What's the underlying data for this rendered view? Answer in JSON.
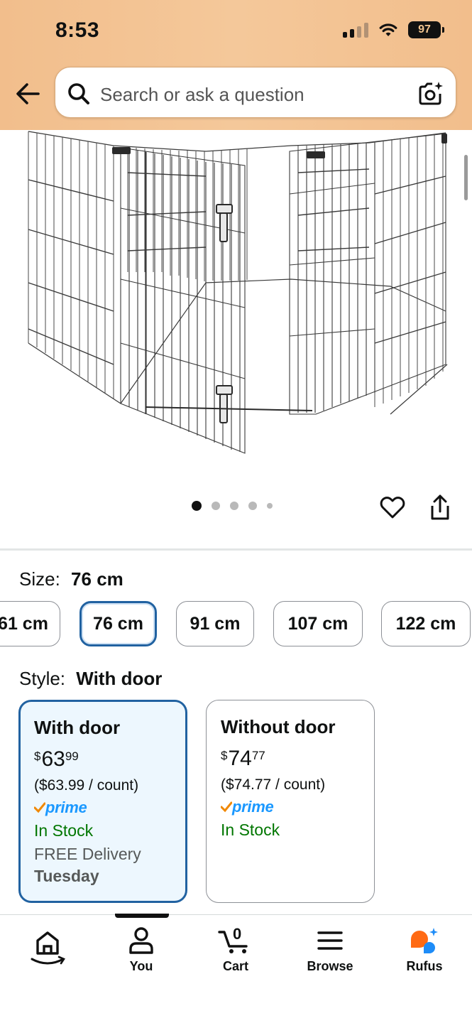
{
  "status_bar": {
    "time": "8:53",
    "battery": "97"
  },
  "search": {
    "placeholder": "Search or ask a question"
  },
  "carousel": {
    "total_images": 5,
    "active_index": 0
  },
  "size": {
    "label": "Size:",
    "selected": "76 cm",
    "options": [
      "61 cm",
      "76 cm",
      "91 cm",
      "107 cm",
      "122 cm"
    ]
  },
  "style": {
    "label": "Style:",
    "selected": "With door",
    "options": [
      {
        "name": "With door",
        "price_symbol": "$",
        "price_whole": "63",
        "price_fraction": "99",
        "unit_price": "($63.99 / count)",
        "prime": "prime",
        "stock": "In Stock",
        "delivery": "FREE Delivery",
        "delivery_day": "Tuesday"
      },
      {
        "name": "Without door",
        "price_symbol": "$",
        "price_whole": "74",
        "price_fraction": "77",
        "unit_price": "($74.77 / count)",
        "prime": "prime",
        "stock": "In Stock"
      }
    ]
  },
  "nav": {
    "cart_count": "0",
    "items": [
      {
        "label": ""
      },
      {
        "label": "You"
      },
      {
        "label": "Cart"
      },
      {
        "label": "Browse"
      },
      {
        "label": "Rufus"
      }
    ]
  },
  "colors": {
    "header_bg": "#f2be8c",
    "selected_border": "#2162a1",
    "selected_bg": "#edf7fe",
    "in_stock": "#007600",
    "prime_blue": "#1a98ff",
    "prime_check": "#f08804",
    "rufus_orange": "#ff6a14",
    "rufus_blue": "#1d8cf8"
  }
}
